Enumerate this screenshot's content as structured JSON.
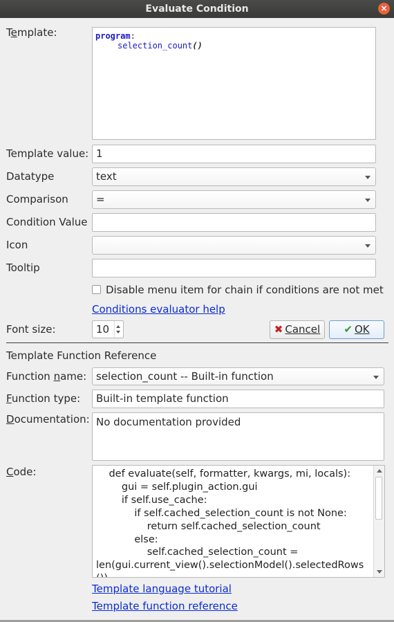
{
  "window": {
    "title": "Evaluate Condition",
    "close_glyph": "×"
  },
  "template": {
    "label": "Template:",
    "code_keyword": "program",
    "code_colon": ":",
    "code_call": "selection_count",
    "code_paren": "()"
  },
  "template_value": {
    "label": "Template value:",
    "value": "1"
  },
  "datatype": {
    "label": "Datatype",
    "value": "text"
  },
  "comparison": {
    "label": "Comparison",
    "value": "="
  },
  "condition_value": {
    "label": "Condition Value",
    "value": ""
  },
  "icon": {
    "label": "Icon",
    "value": ""
  },
  "tooltip": {
    "label": "Tooltip",
    "value": ""
  },
  "disable_checkbox": {
    "label": "Disable menu item for chain if conditions are not met",
    "checked": false
  },
  "help_link": "Conditions evaluator help",
  "font_size": {
    "label": "Font size:",
    "value": "10"
  },
  "buttons": {
    "cancel": "Cancel",
    "ok": "OK"
  },
  "reference": {
    "heading": "Template Function Reference",
    "function_name_label": "Function name:",
    "function_name_value": "selection_count  --  Built-in function",
    "function_type_label": "Function type:",
    "function_type_value": "Built-in template function",
    "documentation_label": "Documentation:",
    "documentation_value": "No documentation provided",
    "code_label": "Code:",
    "code_value": "    def evaluate(self, formatter, kwargs, mi, locals):\n        gui = self.plugin_action.gui\n        if self.use_cache:\n            if self.cached_selection_count is not None:\n                return self.cached_selection_count\n            else:\n                self.cached_selection_count =\nlen(gui.current_view().selectionModel().selectedRows\n())"
  },
  "links": {
    "tutorial": "Template language tutorial",
    "function_reference": "Template function reference"
  },
  "colors": {
    "link": "#0a2bd6",
    "titlebar": "#3a3a38",
    "close": "#e8623c",
    "ok_check": "#2e9b2e",
    "cancel_x": "#c81e1e"
  }
}
